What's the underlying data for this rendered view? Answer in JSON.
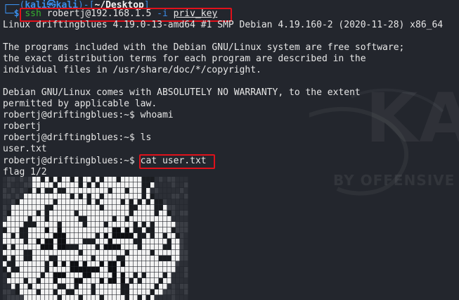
{
  "prompt": {
    "corner_top": "┌──(",
    "user": "kali",
    "at_symbol": "㉿",
    "host": "kali",
    "bracket_mid": ")-[",
    "path": "~/Desktop",
    "bracket_end": "]",
    "corner_bottom": "└─",
    "dollar": "$"
  },
  "ssh_command": {
    "cmd": "ssh",
    "target": "robertj@192.168.1.5",
    "flag": "-i",
    "keyfile": "priv_key"
  },
  "output": {
    "banner": "Linux driftingblues 4.19.0-13-amd64 #1 SMP Debian 4.19.160-2 (2020-11-28) x86_64",
    "motd_1": "The programs included with the Debian GNU/Linux system are free software;",
    "motd_2": "the exact distribution terms for each program are described in the",
    "motd_3": "individual files in /usr/share/doc/*/copyright.",
    "warranty_1": "Debian GNU/Linux comes with ABSOLUTELY NO WARRANTY, to the extent",
    "warranty_2": "permitted by applicable law.",
    "prompt_remote": "robertj@driftingblues:~$",
    "cmd_whoami": "whoami",
    "whoami_result": "robertj",
    "cmd_ls": "ls",
    "ls_result": "user.txt",
    "cmd_cat": "cat user.txt",
    "flag_line": "flag 1/2"
  },
  "watermark": {
    "word": "KALI",
    "tagline": "BY OFFENSIVE S"
  },
  "colors": {
    "background": "#23262d",
    "prompt_blue": "#3b8eea",
    "command_green": "#35b12f",
    "highlight_red": "#e0111b",
    "text": "#e6e6e6"
  }
}
